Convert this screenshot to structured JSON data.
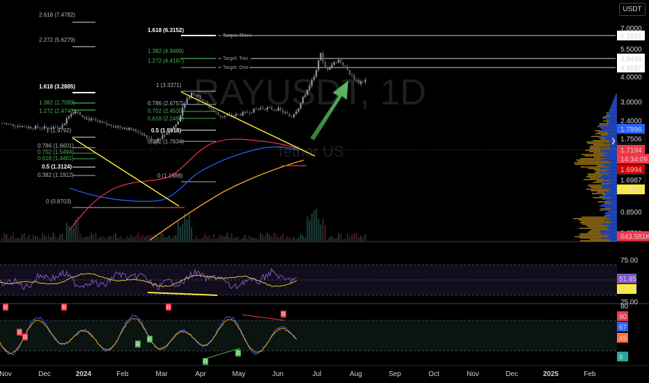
{
  "chart_data": {
    "type": "candlestick",
    "watermark": "RAYUSDT, 1D",
    "watermark_sub": "Tether US",
    "currency": "USDT",
    "price_axis": {
      "scale": "log",
      "ticks": [
        "7.0000",
        "5.5000",
        "4.0000",
        "3.0000",
        "2.4000",
        "0.8500",
        "0.6700"
      ],
      "labels": [
        {
          "text": "6.3152",
          "value": 6.3152,
          "bg": "#ffffff",
          "fg": "#000000"
        },
        {
          "text": "4.9499",
          "value": 4.9499,
          "bg": "#ffffff",
          "fg": "#000000"
        },
        {
          "text": "4.4187",
          "value": 4.4187,
          "bg": "#ffffff",
          "fg": "#000000"
        },
        {
          "text": "1.7896",
          "value": 1.7896,
          "bg": "#2962ff",
          "fg": "#ffffff"
        },
        {
          "text": "1.7506",
          "value": 1.7506,
          "bg": "#000000",
          "fg": "#ffffff"
        },
        {
          "text": "1.7194",
          "value": 1.7194,
          "bg": "#f23645",
          "fg": "#ffffff"
        },
        {
          "text": "14:34:09",
          "value": 1.62,
          "bg": "#f23645",
          "fg": "#ffffff"
        },
        {
          "text": "1.6994",
          "value": 1.5,
          "bg": "#d50000",
          "fg": "#ffffff"
        },
        {
          "text": "1.6987",
          "value": 1.43,
          "bg": "#000000",
          "fg": "#ffffff"
        },
        {
          "text": "1.4408",
          "value": 1.36,
          "bg": "#ffeb3b",
          "fg": "#000000"
        },
        {
          "text": "643.581K",
          "value": 0.66,
          "bg": "#f23645",
          "fg": "#ffffff"
        }
      ]
    },
    "time_axis": [
      "Nov",
      "Dec",
      "2024",
      "Feb",
      "Mar",
      "Apr",
      "May",
      "Jun",
      "Jul",
      "Aug",
      "Sep",
      "Oct",
      "Nov",
      "Dec",
      "2025",
      "Feb"
    ],
    "fib_sets": [
      {
        "levels": [
          {
            "text": "2.618 (7.4782)",
            "color": "#b2b5be"
          },
          {
            "text": "2.272 (5.6279)",
            "color": "#b2b5be"
          },
          {
            "text": "1.618 (3.2885)",
            "color": "#ffffff"
          },
          {
            "text": "1.382 (2.7089)",
            "color": "#4caf50"
          },
          {
            "text": "1.272 (2.4748)",
            "color": "#4caf50"
          },
          {
            "text": "1 (1.9792)",
            "color": "#b2b5be"
          },
          {
            "text": "0.786 (1.6601)",
            "color": "#b2b5be"
          },
          {
            "text": "0.702 (1.5494)",
            "color": "#4caf50"
          },
          {
            "text": "0.618 (1.4461)",
            "color": "#4caf50"
          },
          {
            "text": "0.5 (1.3124)",
            "color": "#ffffff"
          },
          {
            "text": "0.382 (1.1912)",
            "color": "#b2b5be"
          },
          {
            "text": "0 (0.8703)",
            "color": "#b2b5be"
          }
        ]
      },
      {
        "levels": [
          {
            "text": "1.618 (6.3152)",
            "color": "#ffffff"
          },
          {
            "text": "1.382 (4.9499)",
            "color": "#4caf50"
          },
          {
            "text": "1.272 (4.4187)",
            "color": "#4caf50"
          },
          {
            "text": "1 (3.3371)",
            "color": "#b2b5be"
          },
          {
            "text": "0.786 (2.6757)",
            "color": "#b2b5be"
          },
          {
            "text": "0.702 (2.4535)",
            "color": "#4caf50"
          },
          {
            "text": "0.618 (2.2498)",
            "color": "#4caf50"
          },
          {
            "text": "0.5 (1.9918)",
            "color": "#ffffff"
          },
          {
            "text": "0.382 (1.7634)",
            "color": "#b2b5be"
          },
          {
            "text": "0 (1.1888)",
            "color": "#b2b5be"
          }
        ]
      }
    ],
    "targets": [
      "Target: Three",
      "Target: Two",
      "Target: One"
    ],
    "rsi": {
      "ticks": [
        "75.00",
        "25.00"
      ],
      "labels": [
        {
          "text": "51.85",
          "bg": "#7e57c2",
          "fg": "#ffffff"
        },
        {
          "text": "46.07",
          "bg": "#ffeb3b",
          "fg": "#000000"
        }
      ]
    },
    "stoch": {
      "ticks": [
        "80"
      ],
      "labels": [
        {
          "text": "80",
          "bg": "#f23645",
          "fg": "#ffffff"
        },
        {
          "text": "80",
          "bg": "#f23645",
          "fg": "#ffffff"
        },
        {
          "text": "67",
          "bg": "#2962ff",
          "fg": "#ffffff"
        },
        {
          "text": "45",
          "bg": "#ff7043",
          "fg": "#ffffff"
        },
        {
          "text": "8",
          "bg": "#26a69a",
          "fg": "#ffffff"
        }
      ],
      "markers": [
        "R",
        "R",
        "R",
        "R",
        "R",
        "R",
        "R",
        "R",
        "R",
        "R"
      ]
    },
    "colors": {
      "up": "#9598a1",
      "down": "#5d606b",
      "ema_red": "#f23645",
      "ema_blue": "#2962ff",
      "ema_orange": "#f5a623",
      "trend": "#ffeb3b",
      "arrow": "#4caf50"
    }
  }
}
